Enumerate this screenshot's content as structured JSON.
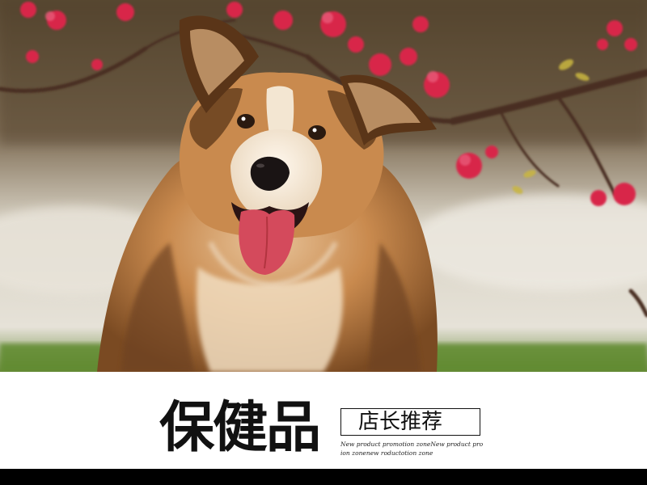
{
  "banner": {
    "headline": "保健品",
    "tag": "店长推荐",
    "promo_line_1": "New product promotion zoneNew product promot",
    "promo_line_2": "ion zonenew roductotion zone"
  },
  "colors": {
    "banner_background": "#ffffff",
    "text": "#111111",
    "footer_bar": "#000000"
  }
}
